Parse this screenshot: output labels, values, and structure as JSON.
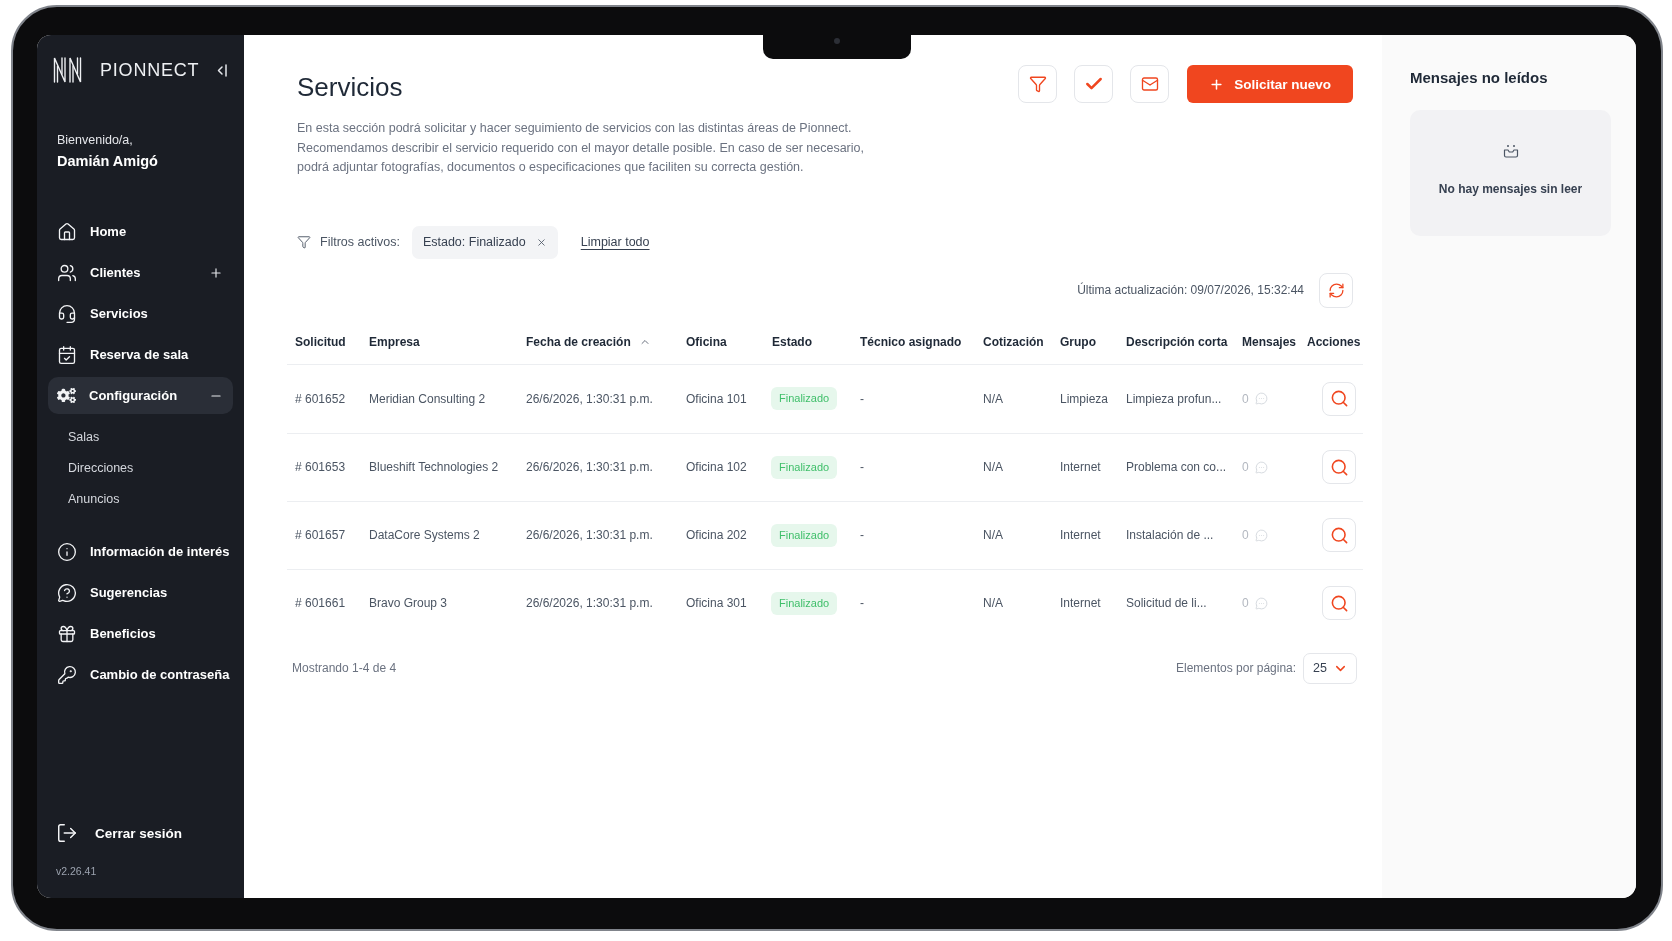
{
  "sidebar": {
    "brand": "PIONNECT",
    "greeting": "Bienvenido/a,",
    "user_name": "Damián Amigó",
    "nav": [
      {
        "label": "Home",
        "kind": "link",
        "selected": false
      },
      {
        "label": "Clientes",
        "kind": "group",
        "selected": false,
        "expanded": false
      },
      {
        "label": "Servicios",
        "kind": "link",
        "selected": false
      },
      {
        "label": "Reserva de sala",
        "kind": "link",
        "selected": false
      },
      {
        "label": "Configuración",
        "kind": "group",
        "selected": true,
        "expanded": true,
        "children": [
          {
            "label": "Salas",
            "selected": false
          },
          {
            "label": "Direcciones",
            "selected": false
          },
          {
            "label": "Anuncios",
            "selected": false
          }
        ]
      },
      {
        "label": "Información de interés",
        "kind": "link",
        "selected": false
      },
      {
        "label": "Sugerencias",
        "kind": "link",
        "selected": false
      },
      {
        "label": "Beneficios",
        "kind": "link",
        "selected": false
      },
      {
        "label": "Cambio de contraseña",
        "kind": "link",
        "selected": false
      }
    ],
    "logout": "Cerrar sesión",
    "version": "v2.26.41"
  },
  "page": {
    "title": "Servicios",
    "description": [
      "En esta sección podrá solicitar y hacer seguimiento de servicios con las distintas áreas de Pionnect.",
      "Recomendamos describir el servicio requerido con el mayor detalle posible. En caso de ser necesario,",
      "podrá adjuntar fotografías, documentos o especificaciones que faciliten su correcta gestión."
    ],
    "new_button": "Solicitar nuevo"
  },
  "filters": {
    "label": "Filtros activos:",
    "chips": [
      {
        "label": "Estado: Finalizado"
      }
    ],
    "clear_all": "Limpiar todo"
  },
  "last_update": "Última actualización: 09/07/2026, 15:32:44",
  "table": {
    "columns": [
      {
        "label": "Solicitud",
        "sorted": false
      },
      {
        "label": "Empresa",
        "sorted": false
      },
      {
        "label": "Fecha de creación",
        "sorted": true
      },
      {
        "label": "Oficina",
        "sorted": false
      },
      {
        "label": "Estado",
        "sorted": false
      },
      {
        "label": "Técnico asignado",
        "sorted": false
      },
      {
        "label": "Cotización",
        "sorted": false
      },
      {
        "label": "Grupo",
        "sorted": false
      },
      {
        "label": "Descripción corta",
        "sorted": false
      },
      {
        "label": "Mensajes",
        "sorted": false
      },
      {
        "label": "Acciones",
        "sorted": false
      }
    ],
    "rows": [
      {
        "request": "# 601652",
        "company": "Meridian Consulting 2",
        "created": "26/6/2026, 1:30:31 p.m.",
        "office": "Oficina 101",
        "status": {
          "label": "Finalizado",
          "kind": "finished"
        },
        "technician": "-",
        "quote": "N/A",
        "group": "Limpieza",
        "short_description": "Limpieza profun...",
        "messages": "0"
      },
      {
        "request": "# 601653",
        "company": "Blueshift Technologies 2",
        "created": "26/6/2026, 1:30:31 p.m.",
        "office": "Oficina 102",
        "status": {
          "label": "Finalizado",
          "kind": "finished"
        },
        "technician": "-",
        "quote": "N/A",
        "group": "Internet",
        "short_description": "Problema con co...",
        "messages": "0"
      },
      {
        "request": "# 601657",
        "company": "DataCore Systems 2",
        "created": "26/6/2026, 1:30:31 p.m.",
        "office": "Oficina 202",
        "status": {
          "label": "Finalizado",
          "kind": "finished"
        },
        "technician": "-",
        "quote": "N/A",
        "group": "Internet",
        "short_description": "Instalación de ...",
        "messages": "0"
      },
      {
        "request": "# 601661",
        "company": "Bravo Group 3",
        "created": "26/6/2026, 1:30:31 p.m.",
        "office": "Oficina 301",
        "status": {
          "label": "Finalizado",
          "kind": "finished"
        },
        "technician": "-",
        "quote": "N/A",
        "group": "Internet",
        "short_description": "Solicitud de li...",
        "messages": "0"
      }
    ]
  },
  "pagination": {
    "summary": "Mostrando 1-4 de 4",
    "page_size_label": "Elementos por página:",
    "page_size": "25"
  },
  "unread_panel": {
    "title": "Mensajes no leídos",
    "empty_text": "No hay mensajes sin leer"
  }
}
